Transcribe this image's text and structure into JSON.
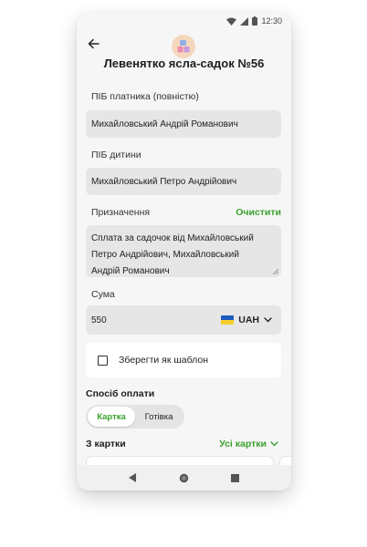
{
  "status_bar": {
    "time": "12:30"
  },
  "header": {
    "title": "Левенятко ясла-садок №56"
  },
  "form": {
    "payer_label": "ПІБ платника (повністю)",
    "payer_value": "Михайловський Андрій Романович",
    "child_label": "ПІБ дитини",
    "child_value": "Михайловський Петро Андрійович",
    "purpose_label": "Призначення",
    "purpose_clear": "Очистити",
    "purpose_lines": [
      "Сплата за садочок від Михайловський",
      "Петро Андрійович, Михайловський",
      "Андрій Романович"
    ],
    "amount_label": "Сума",
    "amount_value": "550",
    "currency": "UAH",
    "save_template": "Зберегти як шаблон"
  },
  "payment": {
    "title": "Спосіб оплати",
    "options": [
      "Картка",
      "Готівка"
    ],
    "selected": "Картка"
  },
  "cards": {
    "title": "З картки",
    "all_cards": "Усі картки"
  },
  "colors": {
    "accent": "#3aa12e",
    "field_bg": "#e6e6e6",
    "flag_blue": "#1e5bbf",
    "flag_yellow": "#f7cf2a"
  }
}
